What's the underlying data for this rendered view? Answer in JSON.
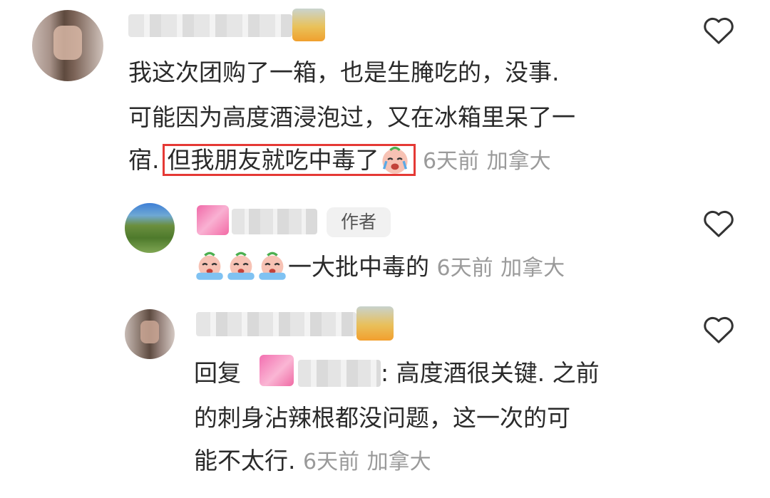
{
  "comments": [
    {
      "text_line1": "我这次团购了一箱，也是生腌吃的，没事.",
      "text_line2": "可能因为高度酒浸泡过，又在冰箱里呆了一",
      "text_line3_start": "宿.",
      "highlighted": "但我朋友就吃中毒了",
      "time": "6天前",
      "location": "加拿大"
    },
    {
      "author_tag": "作者",
      "text": "一大批中毒的",
      "time": "6天前",
      "location": "加拿大"
    },
    {
      "reply_prefix": "回复",
      "text_line1_after": ": 高度酒很关键. 之前",
      "text_line2": "的刺身沾辣根都没问题，这一次的可",
      "text_line3": "能不太行.",
      "time": "6天前",
      "location": "加拿大"
    }
  ],
  "icons": {
    "like": "heart-outline-icon",
    "crying_emoji": "crying-peach-emoji"
  },
  "colors": {
    "text": "#2a2a2a",
    "meta": "#9a9a9a",
    "highlight_border": "#e53935",
    "tag_bg": "#f1f1f1"
  }
}
